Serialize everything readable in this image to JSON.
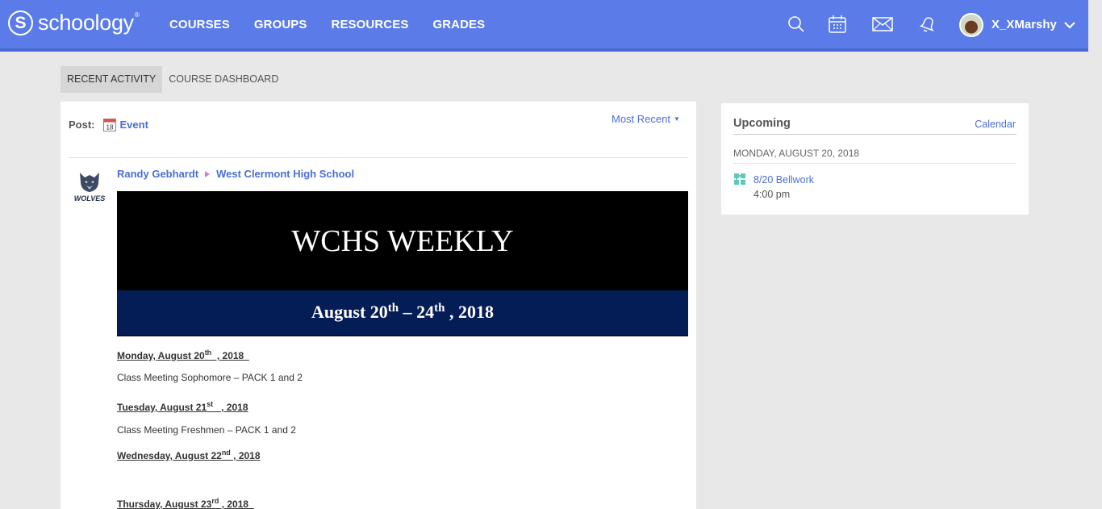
{
  "header": {
    "logo_letter": "S",
    "logo_text": "schoology",
    "logo_mark": "®",
    "nav": [
      "COURSES",
      "GROUPS",
      "RESOURCES",
      "GRADES"
    ],
    "username": "X_XMarshy",
    "icons": [
      "search-icon",
      "calendar-icon",
      "mail-icon",
      "notifications-icon",
      "chevron-down-icon"
    ],
    "brand_color": "#5a7be8"
  },
  "tabs": [
    "RECENT ACTIVITY",
    "COURSE DASHBOARD"
  ],
  "feed": {
    "post_label": "Post:",
    "calendar_day": "18",
    "event_link": "Event",
    "sort_label": "Most Recent",
    "post": {
      "author": "Randy Gebhardt",
      "target": "West Clermont High School",
      "logo_text": "WOLVES",
      "banner_title": "WCHS WEEKLY",
      "banner_date": {
        "prefix": "August  20",
        "sup1": "th",
        "mid": " – 24",
        "sup2": "th",
        "suffix": " , 2018"
      },
      "days": [
        {
          "prefix": "Monday, August 20",
          "sup": "th",
          "suffix": "  , 2018  ",
          "item": "Class Meeting Sophomore – PACK 1 and 2"
        },
        {
          "prefix": "Tuesday, August 21",
          "sup": "st",
          "suffix": "   , 2018",
          "item": "Class Meeting Freshmen – PACK 1 and 2"
        },
        {
          "prefix": "Wednesday, August 22",
          "sup": "nd",
          "suffix": " , 2018",
          "item": ""
        },
        {
          "prefix": "Thursday, August 23",
          "sup": "rd",
          "suffix": " , 2018  ",
          "item": ""
        }
      ]
    }
  },
  "upcoming": {
    "title": "Upcoming",
    "calendar_link": "Calendar",
    "date": "MONDAY, AUGUST 20, 2018",
    "event_name": "8/20 Bellwork",
    "event_time": "4:00 pm"
  }
}
